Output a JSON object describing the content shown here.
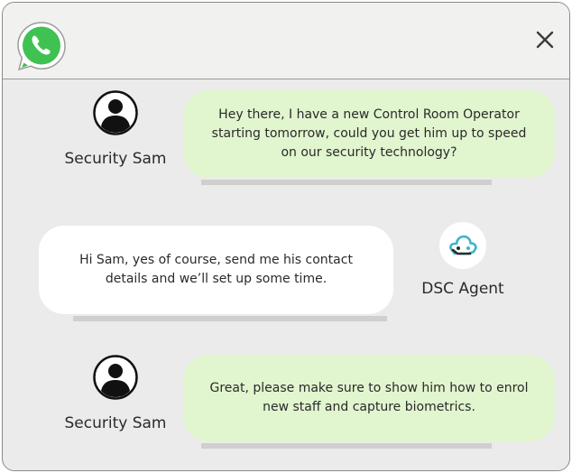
{
  "app": {
    "logo_icon": "whatsapp-icon",
    "close_icon": "close-icon",
    "brand_color": "#3fc251",
    "user_bubble_color": "#e1f5cf",
    "agent_bubble_color": "#ffffff"
  },
  "messages": [
    {
      "sender": "Security Sam",
      "avatar_icon": "user-icon",
      "text": "Hey there, I have a new Control Room Operator starting tomorrow, could you get him up to speed on our security technology?"
    },
    {
      "sender": "DSC Agent",
      "avatar_icon": "cloud-logo-icon",
      "text": "Hi Sam, yes of course, send me his contact details and we’ll set up some time."
    },
    {
      "sender": "Security Sam",
      "avatar_icon": "user-icon",
      "text": "Great, please make sure to show him how to enrol new staff and capture biometrics."
    }
  ]
}
